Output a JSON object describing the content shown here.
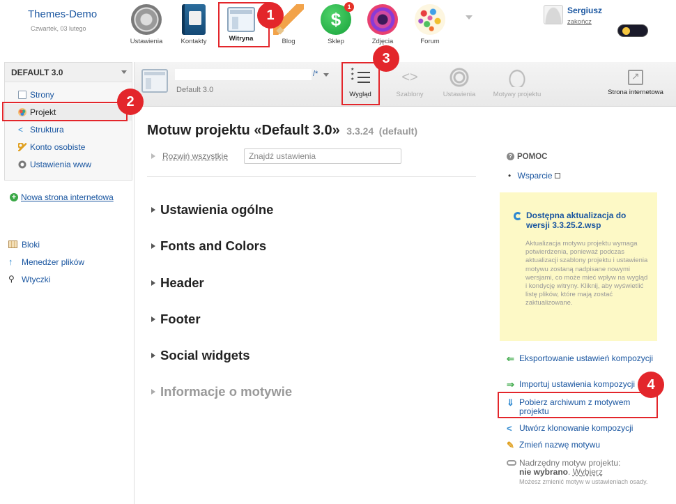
{
  "header": {
    "site_title": "Themes-Demo",
    "date": "Czwartek, 03 lutego",
    "apps": [
      {
        "label": "Ustawienia",
        "icon": "gear-icon"
      },
      {
        "label": "Kontakty",
        "icon": "address-book-icon"
      },
      {
        "label": "Witryna",
        "icon": "site-window-icon"
      },
      {
        "label": "Blog",
        "icon": "pencil-icon"
      },
      {
        "label": "Sklep",
        "icon": "dollar-icon",
        "badge": "1"
      },
      {
        "label": "Zdjęcia",
        "icon": "camera-lens-icon"
      },
      {
        "label": "Forum",
        "icon": "forum-bubbles-icon"
      }
    ],
    "user": {
      "name": "Sergiusz",
      "logout": "zakończ"
    },
    "colors": {
      "link": "#1a56a0",
      "annotation": "#e3262b",
      "update_bg": "#fdf9c6"
    }
  },
  "sidebar": {
    "panel_title": "DEFAULT 3.0",
    "items": [
      {
        "label": "Strony",
        "icon": "page-icon"
      },
      {
        "label": "Projekt",
        "icon": "palette-icon"
      },
      {
        "label": "Struktura",
        "icon": "share-icon"
      },
      {
        "label": "Konto osobiste",
        "icon": "key-icon"
      },
      {
        "label": "Ustawienia www",
        "icon": "gear-icon"
      }
    ],
    "new_site": "Nowa strona internetowa",
    "tools": [
      {
        "label": "Bloki",
        "icon": "blocks-icon"
      },
      {
        "label": "Menedżer plików",
        "icon": "upload-arrow-icon"
      },
      {
        "label": "Wtyczki",
        "icon": "plug-icon"
      }
    ]
  },
  "toolbar": {
    "project_link": "/*",
    "project_subtitle": "Default 3.0",
    "buttons": [
      {
        "label": "Wygląd",
        "icon": "design-list-icon"
      },
      {
        "label": "Szablony",
        "icon": "code-icon"
      },
      {
        "label": "Ustawienia",
        "icon": "gear-icon"
      },
      {
        "label": "Motywy projektu",
        "icon": "cloud-icon"
      },
      {
        "label": "Strona internetowa",
        "icon": "external-link-icon"
      }
    ]
  },
  "main": {
    "title": "Motuw projektu «Default 3.0»",
    "version": "3.3.24",
    "default_tag": "(default)",
    "expand_all": "Rozwiń wszystkie",
    "search_placeholder": "Znajdź ustawienia",
    "sections": [
      "Ustawienia ogólne",
      "Fonts and Colors",
      "Header",
      "Footer",
      "Social widgets",
      "Informacje o motywie"
    ]
  },
  "help": {
    "title": "POMOC",
    "support": "Wsparcie",
    "update_title": "Dostępna aktualizacja do wersji 3.3.25.2.wsp",
    "update_text": "Aktualizacja motywu projektu wymaga potwierdzenia, ponieważ podczas aktualizacji szablony projektu i ustawienia motywu zostaną nadpisane nowymi wersjami, co może mieć wpływ na wygląd i kondycję witryny. Kliknij, aby wyświetlić listę plików, które mają zostać zaktualizowane.",
    "actions": [
      {
        "label": "Eksportowanie ustawień kompozycji",
        "icon": "arrow-left-icon"
      },
      {
        "label": "Importuj ustawienia kompozycji",
        "icon": "arrow-right-icon"
      },
      {
        "label": "Pobierz archiwum z motywem projektu",
        "icon": "download-arrow-icon"
      },
      {
        "label": "Utwórz klonowanie kompozycji",
        "icon": "share-icon"
      },
      {
        "label": "Zmień nazwę motywu",
        "icon": "pencil-icon"
      }
    ],
    "parent_label": "Nadrzędny motyw projektu:",
    "parent_value": "nie wybrano",
    "parent_choose": "Wybierz",
    "parent_note": "Możesz zmienić motyw w ustawieniach osady."
  },
  "annotations": [
    "1",
    "2",
    "3",
    "4"
  ]
}
